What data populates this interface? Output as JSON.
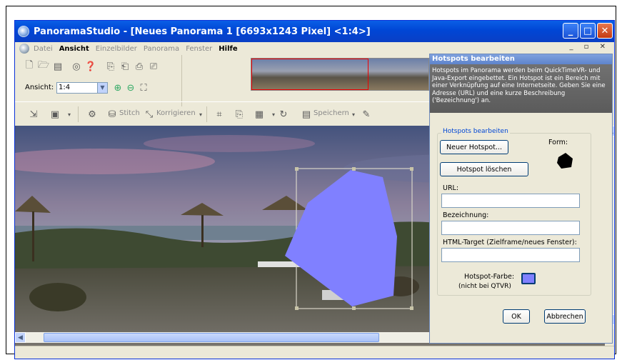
{
  "window": {
    "title": "PanoramaStudio - [Neues Panorama 1 [6693x1243 Pixel] <1:4>]",
    "min": "_",
    "max": "□",
    "close": "✕"
  },
  "menu": {
    "items": [
      "Datei",
      "Ansicht",
      "Einzelbilder",
      "Panorama",
      "Fenster",
      "Hilfe"
    ],
    "mdi": "_ ▫ ✕"
  },
  "toolbar": {
    "ansicht_label": "Ansicht:",
    "zoom_value": "1:4",
    "stitch": "Stitch",
    "korrigieren": "Korrigieren",
    "speichern": "Speichern"
  },
  "panel": {
    "title": "Hotspots bearbeiten",
    "description": "Hotspots im Panorama werden beim QuickTimeVR- und Java-Export eingebettet. Ein Hotspot ist ein Bereich mit einer Verknüpfung auf eine Internetseite. Geben Sie eine Adresse (URL) und eine kurze Beschreibung ('Bezeichnung') an.",
    "group_title": "Hotspots bearbeiten",
    "new_hotspot": "Neuer Hotspot...",
    "delete_hotspot": "Hotspot löschen",
    "form_label": "Form:",
    "url_label": "URL:",
    "url_value": "",
    "bezeichnung_label": "Bezeichnung:",
    "bezeichnung_value": "",
    "target_label": "HTML-Target (Zielframe/neues Fenster):",
    "target_value": "",
    "color_label": "Hotspot-Farbe:",
    "color_note": "(nicht bei QTVR)",
    "hotspot_color": "#8080ff",
    "ok": "OK",
    "cancel": "Abbrechen"
  },
  "colors": {
    "titlebar": "#0046d5",
    "hotspot": "#8080ff"
  }
}
